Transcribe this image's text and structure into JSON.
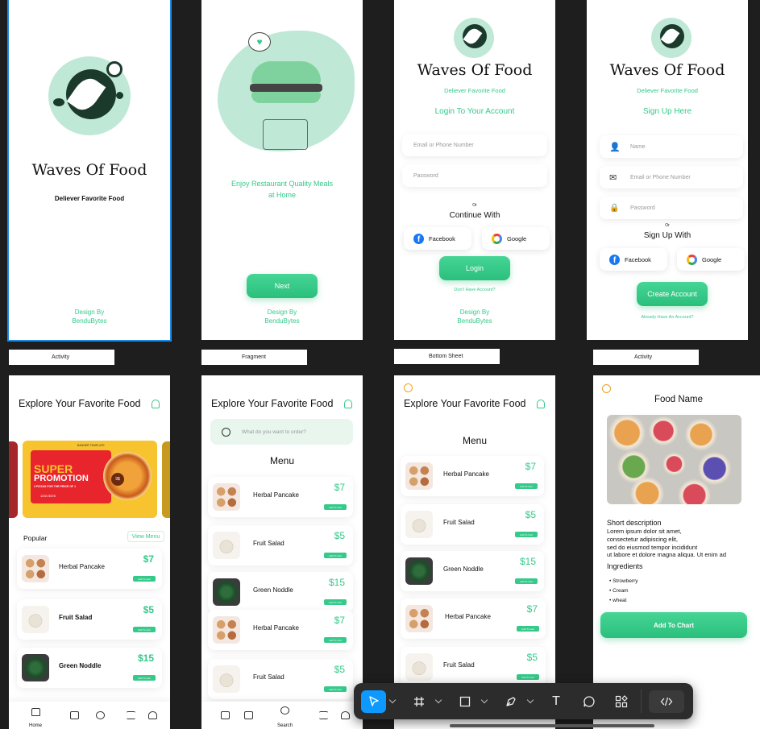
{
  "brand": {
    "app_name": "Waves Of Food",
    "tagline": "Deliever Favorite Food",
    "design_by_1": "Design By",
    "design_by_2": "BenduBytes"
  },
  "labels": [
    "Activity",
    "Fragment",
    "Bottom Sheet",
    "Activity"
  ],
  "splash": {
    "app_name": "Waves Of Food",
    "tagline": "Deliever Favorite Food"
  },
  "onboard": {
    "text_1": "Enjoy Restaurant Quality Meals",
    "text_2": "at Home",
    "next": "Next"
  },
  "login": {
    "subtitle": "Login To Your  Account",
    "email_placeholder": "Email or Phone Number",
    "password_placeholder": "Password",
    "or": "Or",
    "continue_with": "Continue With",
    "facebook": "Facebook",
    "google": "Google",
    "login_button": "Login",
    "no_account": "Don't Have Account?"
  },
  "signup": {
    "subtitle": "Sign Up Here",
    "name_placeholder": "Name",
    "email_placeholder": "Email or Phone Number",
    "password_placeholder": "Password",
    "or": "Or",
    "sign_up_with": "Sign Up With",
    "facebook": "Facebook",
    "google": "Google",
    "create_button": "Create Account",
    "have_account": "Already Have An Account?"
  },
  "home": {
    "title": "Explore Your Favorite Food",
    "banner_small": "BANNER TEMPLATE",
    "banner_super": "SUPER",
    "banner_promotion": "PROMOTION",
    "banner_sub": "2 PIZZAS FOR THE PRICE OF 1",
    "banner_phone": "1234 5678",
    "banner_badge": "9$",
    "popular": "Popular",
    "view_menu": "View Menu",
    "nav_home": "Home"
  },
  "items": [
    {
      "name": "Herbal Pancake",
      "price": "$7",
      "add": "Add To Cart"
    },
    {
      "name": "Fruit Salad",
      "price": "$5",
      "add": "Add To Cart"
    },
    {
      "name": "Green Noddle",
      "price": "$15",
      "add": "Add To Cart"
    }
  ],
  "search": {
    "title": "Explore Your Favorite Food",
    "placeholder": "What do you want to order?",
    "menu": "Menu",
    "nav_search": "Search"
  },
  "sheet": {
    "title": "Explore Your Favorite Food",
    "menu": "Menu"
  },
  "detail": {
    "title": "Food Name",
    "short_desc": "Short   description",
    "desc_1": "Lorem ipsum dolor sit amet,",
    "desc_2": "consectetur adipiscing elit,",
    "desc_3": "sed do eiusmod tempor incididunt",
    "desc_4": "ut labore et dolore magna aliqua. Ut enim ad",
    "ingredients": "Ingredients",
    "ing_1": "Strowberry",
    "ing_2": "Cream",
    "ing_3": "wheat",
    "add_button": "Add To Chart"
  },
  "toolbar": {
    "tools": [
      "move-tool",
      "frame-tool",
      "shape-tool",
      "pen-tool",
      "text-tool",
      "comment-tool",
      "components-tool",
      "dev-mode-toggle"
    ],
    "text_glyph": "T"
  },
  "colors": {
    "accent": "#35c98a",
    "canvas": "#1e1e1e",
    "selection": "#1e88e5",
    "promo_red": "#e8242c",
    "promo_yellow": "#f7c32e"
  }
}
